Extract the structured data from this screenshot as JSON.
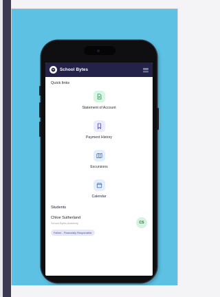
{
  "app": {
    "brand_name": "School Bytes",
    "colors": {
      "header": "#252249",
      "backdrop": "#5cc1e2",
      "tile_green": "#d9f5e3",
      "tile_purple": "#ecebfb",
      "tile_blue": "#e3eefc",
      "avatar_bg": "#d6f3df"
    }
  },
  "quick_links": {
    "title": "Quick links",
    "items": [
      {
        "label": "Statement of Account",
        "icon": "document-icon"
      },
      {
        "label": "Payment History",
        "icon": "bookmark-icon"
      },
      {
        "label": "Excursions",
        "icon": "map-icon"
      },
      {
        "label": "Calendar",
        "icon": "calendar-icon"
      }
    ]
  },
  "students": {
    "title": "Students",
    "list": [
      {
        "name": "Chloe Sutherland",
        "school": "School Bytes Academy",
        "role": "Father - Financially Responsible",
        "initials": "CS"
      }
    ]
  }
}
